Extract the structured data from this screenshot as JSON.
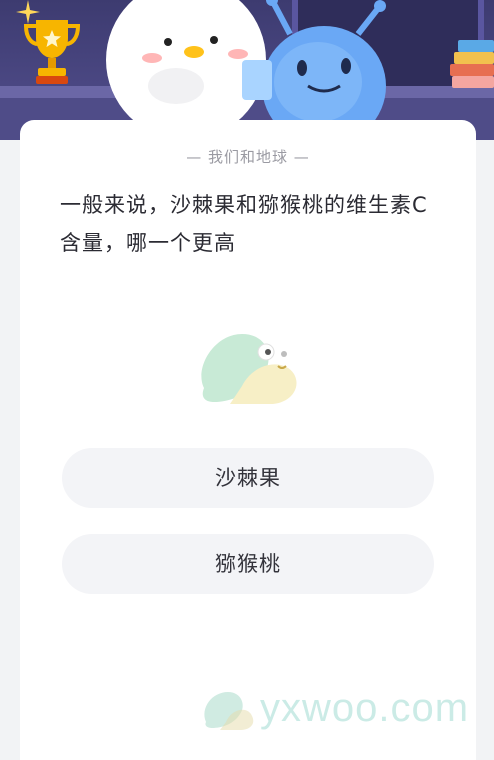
{
  "header": {
    "subtitle": "— 我们和地球 —"
  },
  "question": {
    "text": "一般来说，沙棘果和猕猴桃的维生素C含量，哪一个更高"
  },
  "options": [
    {
      "label": "沙棘果"
    },
    {
      "label": "猕猴桃"
    }
  ],
  "icons": {
    "trophy": "trophy-icon",
    "sparkle": "sparkle-icon",
    "books": "books-icon",
    "mascots": "mascot-illustration",
    "snail": "snail-icon"
  },
  "watermark": {
    "text": "yxwoo.com"
  },
  "colors": {
    "banner": "#4a4782",
    "card": "#ffffff",
    "option_bg": "#f3f4f7",
    "page_bg": "#f2f3f5"
  }
}
